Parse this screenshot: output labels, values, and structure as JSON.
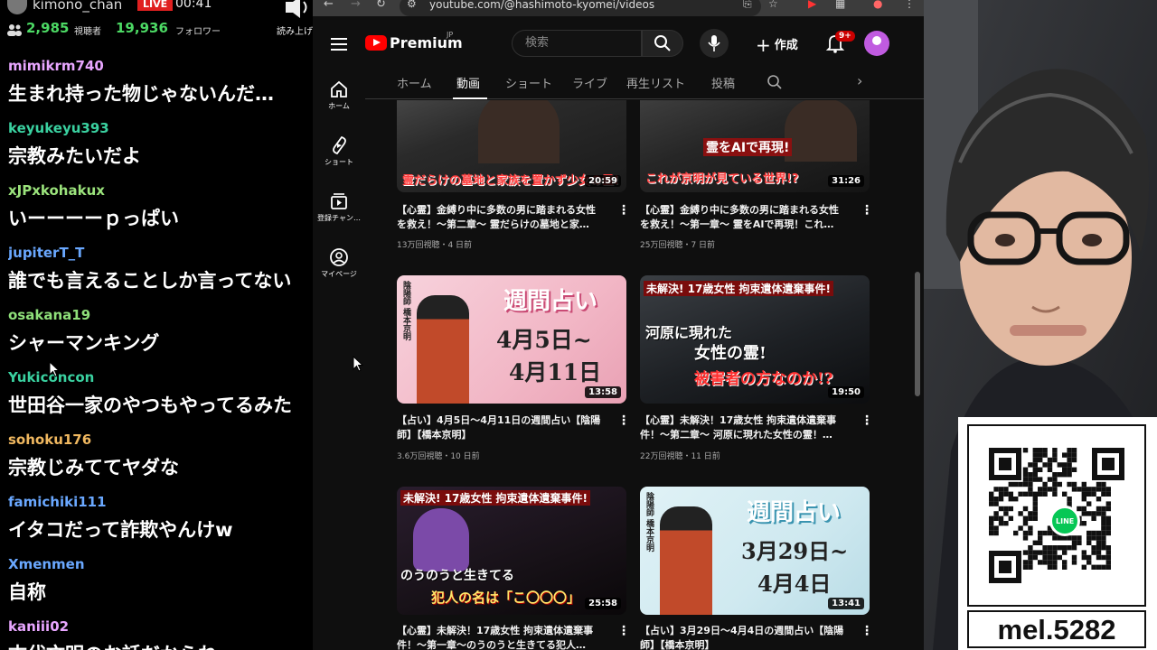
{
  "chat": {
    "channel_name": "kimono_chan",
    "live_badge": "LIVE",
    "elapsed": "00:41",
    "viewers": "2,985",
    "viewers_label": "視聴者",
    "followers": "19,936",
    "followers_label": "フォロワー",
    "readout_label": "読み上げ",
    "messages": [
      {
        "user": "mimikrm740",
        "text": "生まれ持った物じゃないんだ…",
        "color": "#e8a6ff"
      },
      {
        "user": "keyukeyu393",
        "text": "宗教みたいだよ",
        "color": "#3ad1a0"
      },
      {
        "user": "xJPxkohakux",
        "text": "いーーーーｐっぱい",
        "color": "#9be37c"
      },
      {
        "user": "jupiterT_T",
        "text": "誰でも言えることしか言ってない",
        "color": "#6aa8ff"
      },
      {
        "user": "osakana19",
        "text": "シャーマンキング",
        "color": "#8fe07a"
      },
      {
        "user": "Yukiconcon",
        "text": "世田谷一家のやつもやってるみた",
        "color": "#3ad1a0"
      },
      {
        "user": "sohoku176",
        "text": "宗教じみててヤダな",
        "color": "#f0b860"
      },
      {
        "user": "famichiki111",
        "text": "イタコだって詐欺やんけw",
        "color": "#6aa8ff"
      },
      {
        "user": "Xmenmen",
        "text": "自称",
        "color": "#6aa8ff"
      },
      {
        "user": "kaniii02",
        "text": "古代文明のお話だからね",
        "color": "#e8a6ff"
      }
    ]
  },
  "browser": {
    "url": "youtube.com/@hashimoto-kyomei/videos",
    "logo_text": "Premium",
    "logo_region": "JP",
    "search_placeholder": "検索",
    "create_label": "作成",
    "notification_badge": "9+",
    "sidebar": [
      {
        "label": "ホーム",
        "icon": "home-icon"
      },
      {
        "label": "ショート",
        "icon": "shorts-icon"
      },
      {
        "label": "登録チャン…",
        "icon": "subscriptions-icon"
      },
      {
        "label": "マイページ",
        "icon": "my-page-icon"
      }
    ],
    "tabs": [
      "ホーム",
      "動画",
      "ショート",
      "ライブ",
      "再生リスト",
      "投稿"
    ],
    "active_tab": "動画"
  },
  "videos": [
    {
      "duration": "20:59",
      "thumb_text": "霊だらけの墓地と家族を置かず少女の霊!",
      "title_line1": "【心霊】金縛り中に多数の男に踏まれる女性",
      "title_line2": "を救え！～第二章～ 霊だらけの墓地と家…",
      "meta": "13万回視聴・4 日前"
    },
    {
      "duration": "31:26",
      "thumb_text_top": "霊をAIで再現!",
      "thumb_text": "これが京明が見ている世界!?",
      "title_line1": "【心霊】金縛り中に多数の男に踏まれる女性",
      "title_line2": "を救え！～第一章～ 霊をAIで再現！これ…",
      "meta": "25万回視聴・7 日前"
    },
    {
      "duration": "13:58",
      "thumb_header": "週間占い",
      "thumb_line1": "4月5日~",
      "thumb_line2": "4月11日",
      "thumb_side": "陰陽師 橋本京明",
      "title_line1": "【占い】4月5日～4月11日の週間占い【陰陽",
      "title_line2": "師】【橋本京明】",
      "meta": "3.6万回視聴・10 日前"
    },
    {
      "duration": "19:50",
      "thumb_header": "未解決! 17歳女性 拘束遺体遺棄事件!",
      "thumb_line1": "河原に現れた",
      "thumb_line2": "女性の霊!",
      "thumb_line3": "被害者の方なのか!?",
      "title_line1": "【心霊】未解決！17歳女性 拘束遺体遺棄事",
      "title_line2": "件！～第二章～ 河原に現れた女性の霊！…",
      "meta": "22万回視聴・11 日前"
    },
    {
      "duration": "25:58",
      "thumb_header": "未解決! 17歳女性 拘束遺体遺棄事件!",
      "thumb_line1": "のうのうと生きてる",
      "thumb_line2": "犯人の名は「こ〇〇〇」",
      "title_line1": "【心霊】未解決！17歳女性 拘束遺体遺棄事",
      "title_line2": "件！～第一章～のうのうと生きてる犯人…",
      "meta": ""
    },
    {
      "duration": "13:41",
      "thumb_header": "週間占い",
      "thumb_line1": "3月29日~",
      "thumb_line2": "4月4日",
      "thumb_side": "陰陽師 橋本京明",
      "title_line1": "【占い】3月29日～4月4日の週間占い【陰陽",
      "title_line2": "師】【橋本京明】",
      "meta": ""
    }
  ],
  "qr": {
    "logo_text": "LINE",
    "caption": "mel.5282"
  },
  "colors": {
    "accent_red": "#ff0000",
    "live_red": "#e02020",
    "viewer_green": "#4cd964",
    "line_green": "#06c755"
  }
}
